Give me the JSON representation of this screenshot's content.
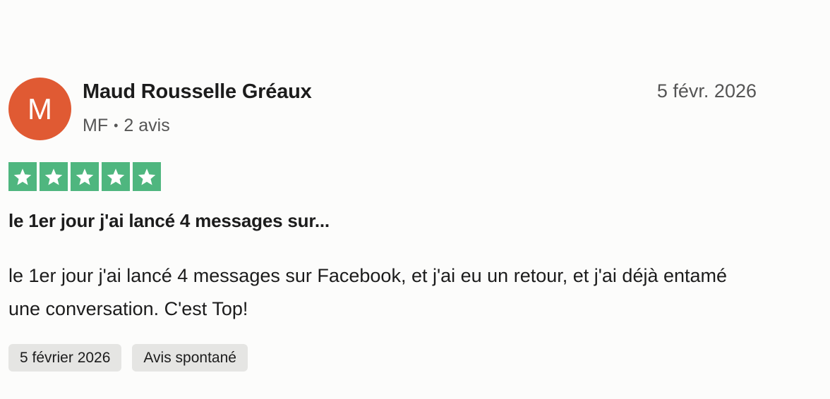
{
  "reviewer": {
    "initial": "M",
    "avatar_color": "#e05a33",
    "name": "Maud Rousselle Gréaux",
    "country": "MF",
    "separator": "•",
    "reviews_count": "2 avis"
  },
  "review": {
    "date": "5 févr. 2026",
    "rating": 5,
    "max_rating": 5,
    "star_color": "#4fb67f",
    "title": "le 1er jour j'ai lancé 4 messages sur...",
    "text": "le 1er jour j'ai lancé 4 messages sur Facebook, et j'ai eu un retour, et j'ai déjà entamé une conversation. C'est Top!",
    "tags": [
      "5 février 2026",
      "Avis spontané"
    ]
  }
}
